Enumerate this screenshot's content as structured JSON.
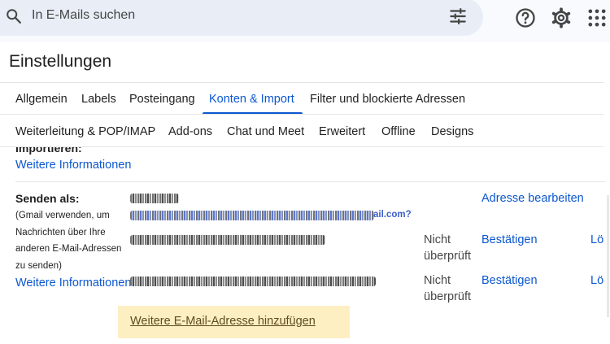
{
  "search": {
    "placeholder": "In E-Mails suchen"
  },
  "icons": {
    "search": "search-icon",
    "tune": "tune-icon",
    "help": "help-icon",
    "settings": "gear-icon",
    "apps": "apps-grid-icon"
  },
  "page": {
    "title": "Einstellungen"
  },
  "tabs_row1": [
    "Allgemein",
    "Labels",
    "Posteingang",
    "Konten & Import",
    "Filter und blockierte Adressen"
  ],
  "tabs_row2": [
    "Weiterleitung & POP/IMAP",
    "Add-ons",
    "Chat und Meet",
    "Erweitert",
    "Offline",
    "Designs"
  ],
  "active_tab": "Konten & Import",
  "import_section": {
    "heading_cut": "Importieren:",
    "link": "Weitere Informationen"
  },
  "send_as": {
    "heading": "Senden als:",
    "description_lines": [
      "(Gmail verwenden, um",
      "Nachrichten über Ihre",
      "anderen E-Mail-Adressen",
      "zu senden)"
    ],
    "link": "Weitere Informationen",
    "rows": [
      {
        "address_suffix": "ail.com?",
        "action": "Adresse bearbeiten"
      },
      {
        "status_line1": "Nicht",
        "status_line2": "überprüft",
        "action": "Bestätigen",
        "extra": "Lö"
      },
      {
        "status_line1": "Nicht",
        "status_line2": "überprüft",
        "action": "Bestätigen",
        "extra": "Lö"
      }
    ],
    "add_button": "Weitere E-Mail-Adresse hinzufügen"
  },
  "colors": {
    "accent": "#0b57d0",
    "search_bg": "#e9eef6",
    "highlight": "#feefc3"
  }
}
